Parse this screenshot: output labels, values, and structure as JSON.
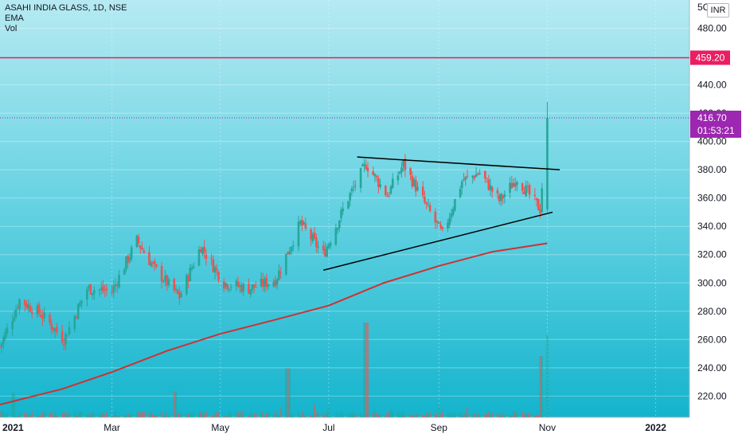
{
  "legend": {
    "symbol_line": "ASAHI INDIA GLASS, 1D, NSE",
    "ema_label": "EMA",
    "vol_label": "Vol"
  },
  "currency_button": "INR",
  "price_axis": {
    "top_clipped_label": "5C",
    "ticks": [
      "480.00",
      "440.00",
      "420.00",
      "400.00",
      "380.00",
      "360.00",
      "340.00",
      "320.00",
      "300.00",
      "280.00",
      "260.00",
      "240.00",
      "220.00"
    ]
  },
  "time_axis": {
    "ticks": [
      "2021",
      "Mar",
      "May",
      "Jul",
      "Sep",
      "Nov",
      "2022"
    ]
  },
  "badges": {
    "alert_level": "459.20",
    "last_price": "416.70",
    "countdown": "01:53:21"
  },
  "colors": {
    "background_top": "#a9e6f0",
    "background_bottom": "#18b6cf",
    "up_candle": "#26a69a",
    "down_candle": "#ef5350",
    "ema_line": "#d32f2f",
    "alert_line": "#e91e63",
    "last_price_badge": "#9c27b0",
    "volume_up": "#26a69a",
    "volume_down": "#ef5350",
    "trendline": "#000000"
  },
  "chart_data": {
    "type": "candlestick",
    "title": "ASAHI INDIA GLASS, 1D, NSE",
    "interval": "1D",
    "exchange": "NSE",
    "currency": "INR",
    "ylim": [
      205,
      500
    ],
    "xlim": [
      "2020-12-28",
      "2022-01-20"
    ],
    "last_price": 416.7,
    "alert_level": 459.2,
    "legend_placement": "top-left",
    "grid": true,
    "price_waypoints": [
      {
        "date": "2020-12-28",
        "close": 255
      },
      {
        "date": "2021-01-08",
        "close": 288
      },
      {
        "date": "2021-01-20",
        "close": 278
      },
      {
        "date": "2021-02-02",
        "close": 260
      },
      {
        "date": "2021-02-15",
        "close": 296
      },
      {
        "date": "2021-03-01",
        "close": 294
      },
      {
        "date": "2021-03-15",
        "close": 330
      },
      {
        "date": "2021-03-25",
        "close": 310
      },
      {
        "date": "2021-04-08",
        "close": 290
      },
      {
        "date": "2021-04-20",
        "close": 326
      },
      {
        "date": "2021-05-03",
        "close": 300
      },
      {
        "date": "2021-05-17",
        "close": 296
      },
      {
        "date": "2021-06-01",
        "close": 302
      },
      {
        "date": "2021-06-15",
        "close": 342
      },
      {
        "date": "2021-06-28",
        "close": 320
      },
      {
        "date": "2021-07-12",
        "close": 360
      },
      {
        "date": "2021-07-22",
        "close": 384
      },
      {
        "date": "2021-08-03",
        "close": 362
      },
      {
        "date": "2021-08-12",
        "close": 384
      },
      {
        "date": "2021-08-25",
        "close": 354
      },
      {
        "date": "2021-09-03",
        "close": 334
      },
      {
        "date": "2021-09-14",
        "close": 372
      },
      {
        "date": "2021-09-24",
        "close": 378
      },
      {
        "date": "2021-10-05",
        "close": 358
      },
      {
        "date": "2021-10-15",
        "close": 374
      },
      {
        "date": "2021-10-25",
        "close": 357
      },
      {
        "date": "2021-10-28",
        "close": 352
      },
      {
        "date": "2021-11-01",
        "close": 416.7
      }
    ],
    "ema_points": [
      {
        "date": "2020-12-28",
        "value": 214
      },
      {
        "date": "2021-02-01",
        "value": 225
      },
      {
        "date": "2021-03-01",
        "value": 237
      },
      {
        "date": "2021-04-01",
        "value": 252
      },
      {
        "date": "2021-05-01",
        "value": 264
      },
      {
        "date": "2021-06-01",
        "value": 274
      },
      {
        "date": "2021-07-01",
        "value": 284
      },
      {
        "date": "2021-08-01",
        "value": 300
      },
      {
        "date": "2021-09-01",
        "value": 312
      },
      {
        "date": "2021-10-01",
        "value": 322
      },
      {
        "date": "2021-11-01",
        "value": 328
      }
    ],
    "trendlines": [
      {
        "name": "upper",
        "start": {
          "date": "2021-07-17",
          "value": 389
        },
        "end": {
          "date": "2021-11-08",
          "value": 380
        }
      },
      {
        "name": "lower",
        "start": {
          "date": "2021-06-28",
          "value": 309
        },
        "end": {
          "date": "2021-11-04",
          "value": 350
        }
      }
    ],
    "volume_spikes": [
      {
        "date": "2021-01-04",
        "relative": 0.22
      },
      {
        "date": "2021-04-05",
        "relative": 0.23
      },
      {
        "date": "2021-06-08",
        "relative": 0.44
      },
      {
        "date": "2021-07-22",
        "relative": 0.85
      },
      {
        "date": "2021-10-29",
        "relative": 0.55
      },
      {
        "date": "2021-11-01",
        "relative": 0.74
      }
    ]
  }
}
